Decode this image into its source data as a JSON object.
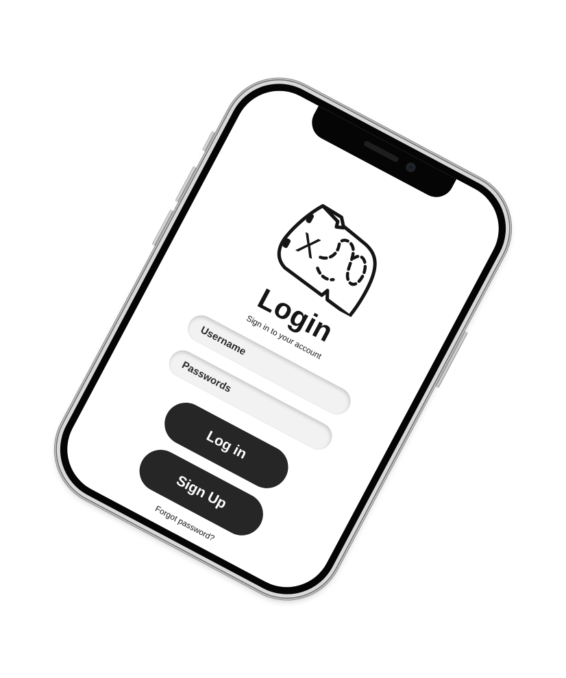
{
  "login": {
    "title": "Login",
    "subtitle": "Sign in to your account",
    "username_placeholder": "Username",
    "password_placeholder": "Passwords",
    "login_label": "Log in",
    "signup_label": "Sign Up",
    "forgot_label": "Forgot password?"
  },
  "logo": {
    "icon": "treasure-map-icon",
    "mark": "X"
  },
  "colors": {
    "button": "#262626",
    "field": "#f2f2f2",
    "phone_body": "#050505",
    "text": "#151515"
  }
}
